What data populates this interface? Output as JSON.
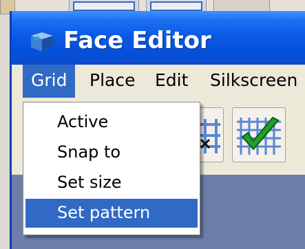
{
  "window": {
    "title": "Face Editor",
    "app_icon": "cube-icon"
  },
  "menubar": {
    "items": [
      {
        "label": "Grid",
        "active": true
      },
      {
        "label": "Place"
      },
      {
        "label": "Edit"
      },
      {
        "label": "Silkscreen"
      }
    ]
  },
  "grid_menu": {
    "items": [
      {
        "label": "Active"
      },
      {
        "label": "Snap to"
      },
      {
        "label": "Set size"
      },
      {
        "label": "Set pattern",
        "highlighted": true
      }
    ]
  },
  "toolbar": {
    "buttons": [
      {
        "icon": "grid-point-icon"
      },
      {
        "icon": "grid-check-icon"
      }
    ]
  },
  "colors": {
    "title_bar": "#0a52de",
    "menu_highlight": "#316ac5",
    "menu_background": "#ece9d8",
    "workspace": "#6d7ea8",
    "check_green": "#1fa02a"
  }
}
